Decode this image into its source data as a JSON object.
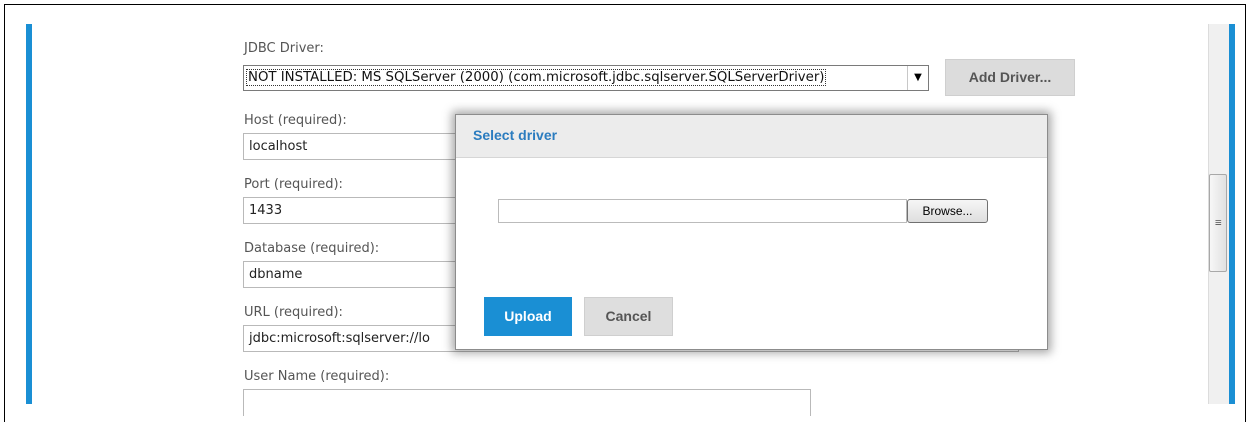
{
  "form": {
    "jdbc_driver": {
      "label": "JDBC Driver:",
      "selected": "NOT INSTALLED: MS SQLServer (2000) (com.microsoft.jdbc.sqlserver.SQLServerDriver)",
      "add_button": "Add Driver..."
    },
    "host": {
      "label": "Host (required):",
      "value": "localhost"
    },
    "port": {
      "label": "Port (required):",
      "value": "1433"
    },
    "database": {
      "label": "Database (required):",
      "value": "dbname"
    },
    "url": {
      "label": "URL (required):",
      "value": "jdbc:microsoft:sqlserver://lo"
    },
    "username": {
      "label": "User Name (required):",
      "value": ""
    }
  },
  "dialog": {
    "title": "Select driver",
    "file_value": "",
    "browse_label": "Browse...",
    "upload_label": "Upload",
    "cancel_label": "Cancel"
  },
  "colors": {
    "accent": "#1a8fd4",
    "dialog_title": "#2b7cbf",
    "button_gray": "#dcdcdc"
  }
}
